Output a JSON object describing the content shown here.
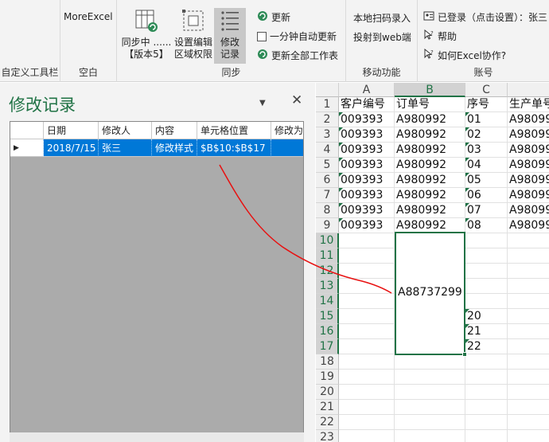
{
  "ribbon": {
    "custom_toolbar": "自定义工具栏",
    "more_excel": "MoreExcel",
    "blank_group": "空白",
    "sync_group": "同步",
    "sync_btn_line1": "同步中 ......",
    "sync_btn_line2": "【版本5】",
    "perm_btn_line1": "设置编辑",
    "perm_btn_line2": "区域权限",
    "modify_btn_line1": "修改",
    "modify_btn_line2": "记录",
    "refresh": "更新",
    "auto_refresh": "一分钟自动更新",
    "refresh_all": "更新全部工作表",
    "mobile_group": "移动功能",
    "scan_input": "本地扫码录入",
    "project_web": "投射到web端",
    "account_group": "账号",
    "logged_in": "已登录（点击设置）：张三",
    "help": "帮助",
    "how_collab": "如何Excel协作?"
  },
  "pane": {
    "title": "修改记录",
    "columns": [
      "日期",
      "修改人",
      "内容",
      "单元格位置",
      "修改为"
    ],
    "rows": [
      {
        "date": "2018/7/15",
        "user": "张三",
        "content": "修改样式",
        "cell": "$B$10:$B$17"
      }
    ]
  },
  "sheet": {
    "col_headers": [
      "A",
      "B",
      "C",
      ""
    ],
    "row_headers": [
      "1",
      "2",
      "3",
      "4",
      "5",
      "6",
      "7",
      "8",
      "9",
      "10",
      "11",
      "12",
      "13",
      "14",
      "15",
      "16",
      "17",
      "18",
      "19",
      "20",
      "21",
      "22",
      "23"
    ],
    "header_row": [
      "客户编号",
      "订单号",
      "序号",
      "生产单号"
    ],
    "data_rows": [
      [
        "009393",
        "A980992",
        "01",
        "A98099"
      ],
      [
        "009393",
        "A980992",
        "02",
        "A98099"
      ],
      [
        "009393",
        "A980992",
        "03",
        "A98099"
      ],
      [
        "009393",
        "A980992",
        "04",
        "A98099"
      ],
      [
        "009393",
        "A980992",
        "05",
        "A98099"
      ],
      [
        "009393",
        "A980992",
        "06",
        "A98099"
      ],
      [
        "009393",
        "A980992",
        "07",
        "A98099"
      ],
      [
        "009393",
        "A980992",
        "08",
        "A98099"
      ]
    ],
    "merged_value": "A88737299",
    "c_values": [
      "20",
      "21",
      "22"
    ],
    "colors": {
      "accent": "#217346",
      "selection": "#0078d7",
      "annotation": "#e81010"
    }
  }
}
